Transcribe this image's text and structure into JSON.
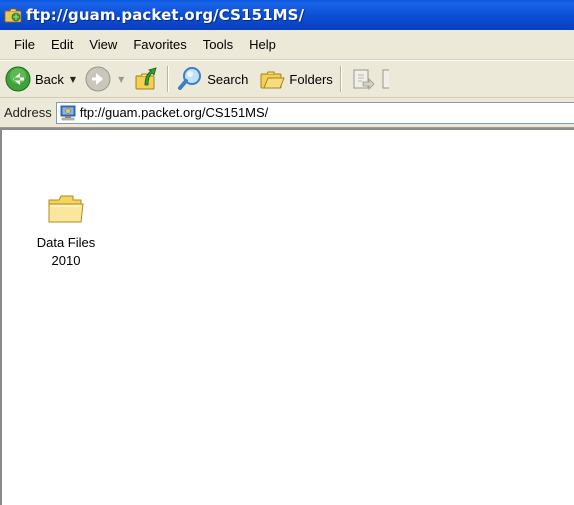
{
  "window": {
    "title": "ftp://guam.packet.org/CS151MS/"
  },
  "menu": {
    "items": [
      "File",
      "Edit",
      "View",
      "Favorites",
      "Tools",
      "Help"
    ]
  },
  "toolbar": {
    "back_label": "Back",
    "search_label": "Search",
    "folders_label": "Folders"
  },
  "address": {
    "label": "Address",
    "value": "ftp://guam.packet.org/CS151MS/"
  },
  "content": {
    "items": [
      {
        "name_line1": "Data Files",
        "name_line2": "2010",
        "icon": "folder-icon"
      }
    ]
  },
  "colors": {
    "titlebar": "#0b4fd6",
    "chrome": "#ece9d8",
    "folder": "#f5d76e"
  }
}
